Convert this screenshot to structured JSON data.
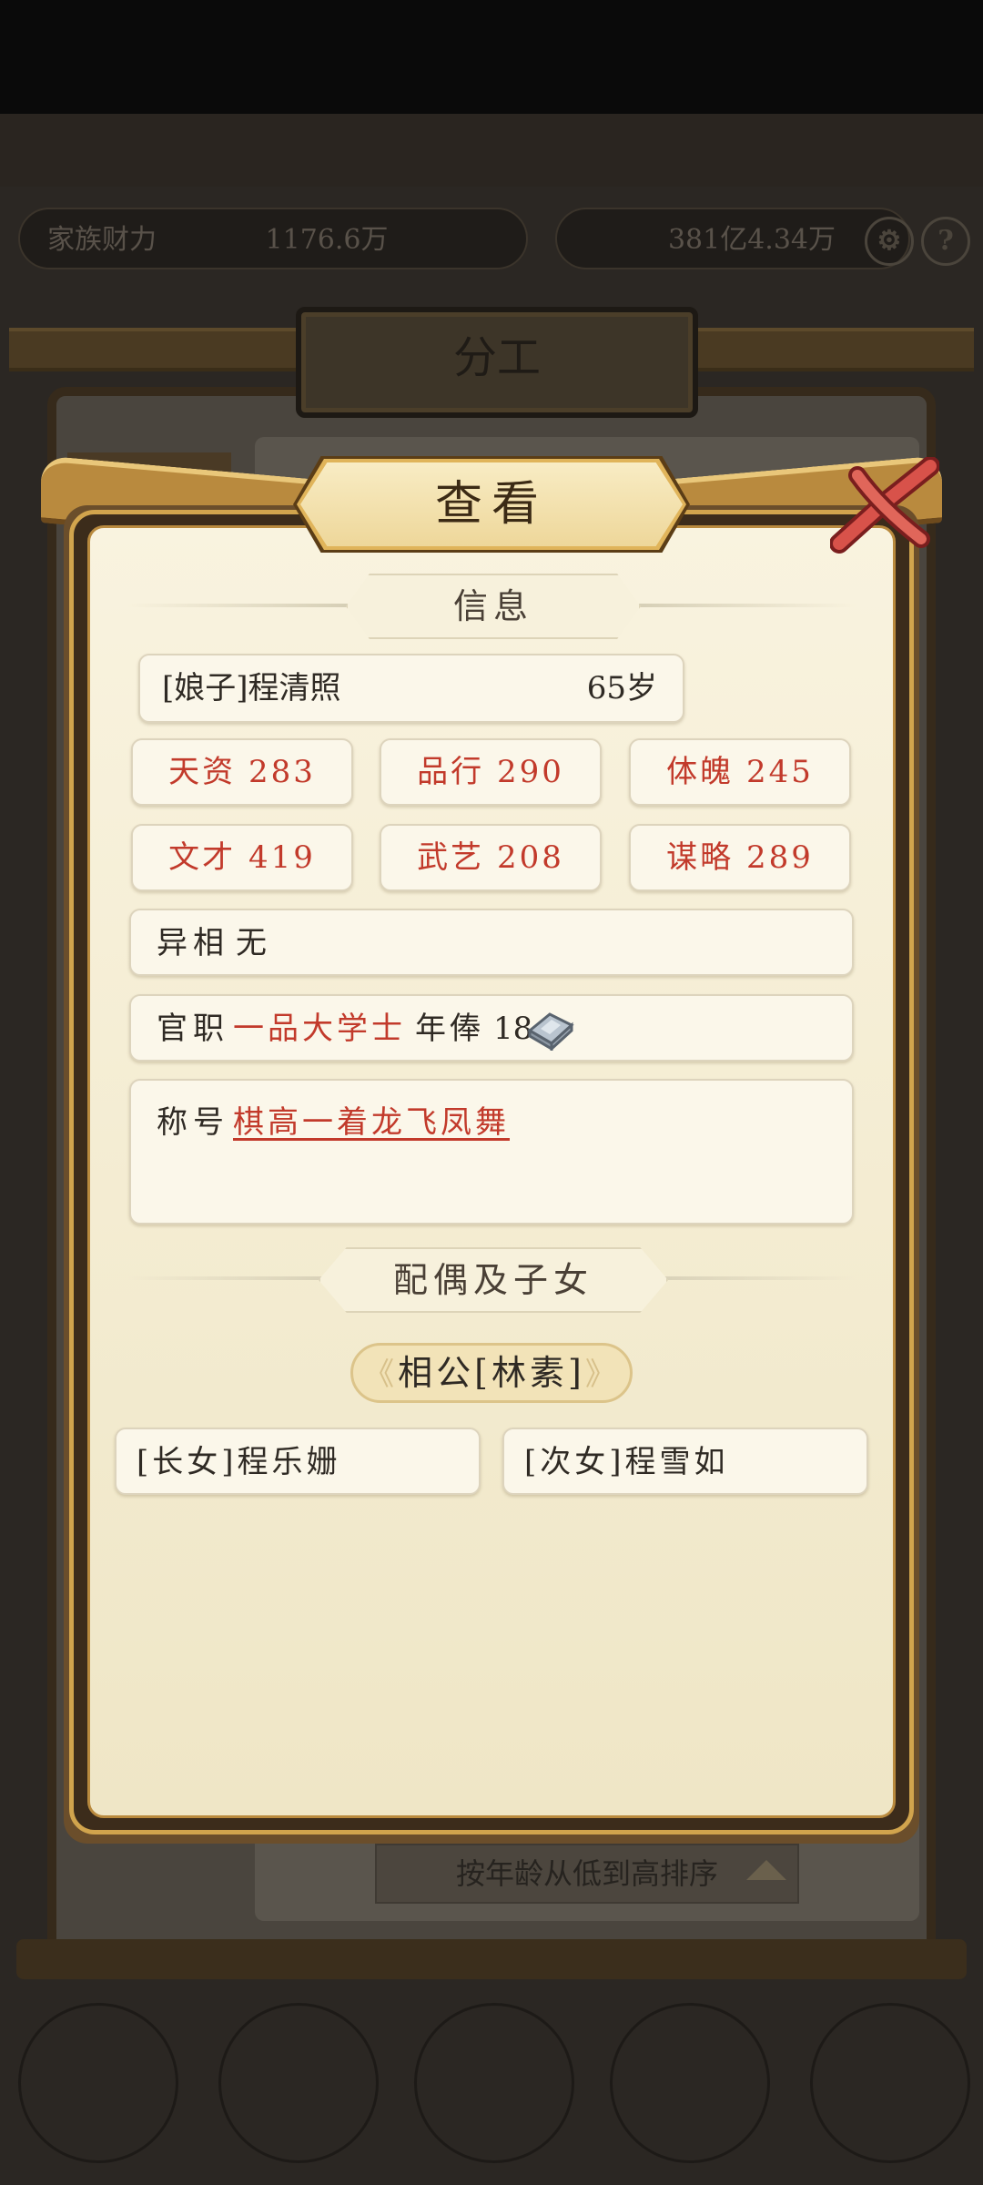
{
  "background": {
    "resources": [
      {
        "label": "家族财力",
        "value": "1176.6万"
      },
      {
        "label": "",
        "value": "381亿4.34万"
      }
    ],
    "panel_title": "分工",
    "sort_button_label": "按年龄从低到高排序"
  },
  "dialog": {
    "title": "查看",
    "info_section": {
      "header": "信息",
      "person": {
        "name": "[娘子]程清照",
        "age": "65岁"
      },
      "stats": [
        {
          "label": "天资",
          "value": "283"
        },
        {
          "label": "品行",
          "value": "290"
        },
        {
          "label": "体魄",
          "value": "245"
        },
        {
          "label": "文才",
          "value": "419"
        },
        {
          "label": "武艺",
          "value": "208"
        },
        {
          "label": "谋略",
          "value": "289"
        }
      ],
      "appearance": {
        "label": "异相",
        "value": "无"
      },
      "office": {
        "label": "官职",
        "value": "一品大学士",
        "salary_label": "年俸",
        "salary_value": "18"
      },
      "title_field": {
        "label": "称号",
        "value": "棋高一着龙飞凤舞"
      }
    },
    "family_section": {
      "header": "配偶及子女",
      "spouse": "相公[林素]",
      "children": [
        "[长女]程乐姗",
        "[次女]程雪如"
      ]
    }
  },
  "icons": {
    "silver": "silver-ingot-icon",
    "close": "close-x-icon"
  }
}
